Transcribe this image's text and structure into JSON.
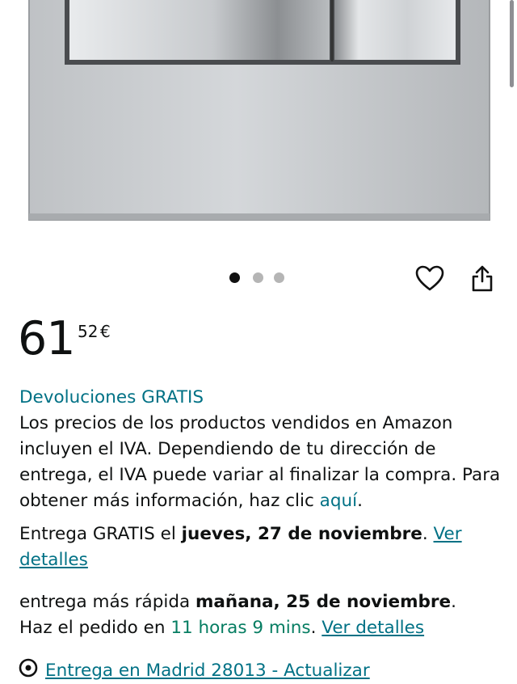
{
  "product": {
    "carousel": {
      "count": 3,
      "active_index": 0
    },
    "actions": {
      "favorite_icon": "heart-outline-icon",
      "share_icon": "share-icon"
    }
  },
  "price": {
    "whole": "61",
    "fraction": "52",
    "currency": "€"
  },
  "returns": {
    "label": "Devoluciones GRATIS"
  },
  "vat": {
    "text": "Los precios de los productos vendidos en Amazon incluyen el IVA. Dependiendo de tu dirección de entrega, el IVA puede variar al finalizar la compra. Para obtener más información, haz clic ",
    "link": "aquí",
    "end": "."
  },
  "delivery": {
    "prefix": "Entrega GRATIS el ",
    "date": "jueves, 27 de noviembre",
    "suffix": ". ",
    "details_link": "Ver detalles"
  },
  "fast_delivery": {
    "prefix": "entrega más rápida ",
    "date": "mañana, 25 de noviembre",
    "suffix": ".",
    "order_prefix": "Haz el pedido en ",
    "countdown": "11 horas 9 mins",
    "order_suffix": ". ",
    "details_link": "Ver detalles"
  },
  "location": {
    "icon": "location-pin-icon",
    "text": "Entrega en Madrid 28013 - Actualizar"
  },
  "colors": {
    "link": "#007185",
    "countdown": "#067d62",
    "text": "#0f1111"
  }
}
